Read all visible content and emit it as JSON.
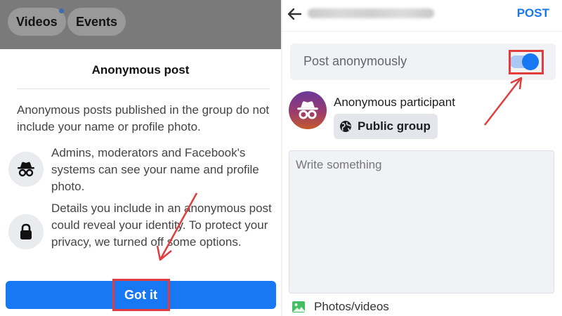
{
  "left_panel": {
    "tabs": [
      {
        "label": "Videos",
        "has_dot": true
      },
      {
        "label": "Events"
      }
    ],
    "sheet": {
      "title": "Anonymous post",
      "intro": "Anonymous posts published in the group do not include your name or profile photo.",
      "items": [
        {
          "icon": "incognito-icon",
          "text": "Admins, moderators and Facebook's systems can see your name and profile photo."
        },
        {
          "icon": "lock-icon",
          "text": "Details you include in an anonymous post could reveal your identity. To protect your privacy, we turned off some options."
        }
      ],
      "button_label": "Got it"
    }
  },
  "right_panel": {
    "header": {
      "back_icon": "back-arrow-icon",
      "post_label": "POST"
    },
    "anonymous_toggle": {
      "label": "Post anonymously",
      "enabled": true
    },
    "participant": {
      "avatar_icon": "incognito-icon",
      "name": "Anonymous participant",
      "audience_icon": "globe-icon",
      "audience_label": "Public group"
    },
    "composer": {
      "placeholder": "Write something"
    },
    "attachments": {
      "icon": "photo-icon",
      "label": "Photos/videos"
    }
  },
  "colors": {
    "accent": "#1877f2",
    "highlight": "#e23d3d",
    "toggle_track": "#a9c8f4"
  }
}
